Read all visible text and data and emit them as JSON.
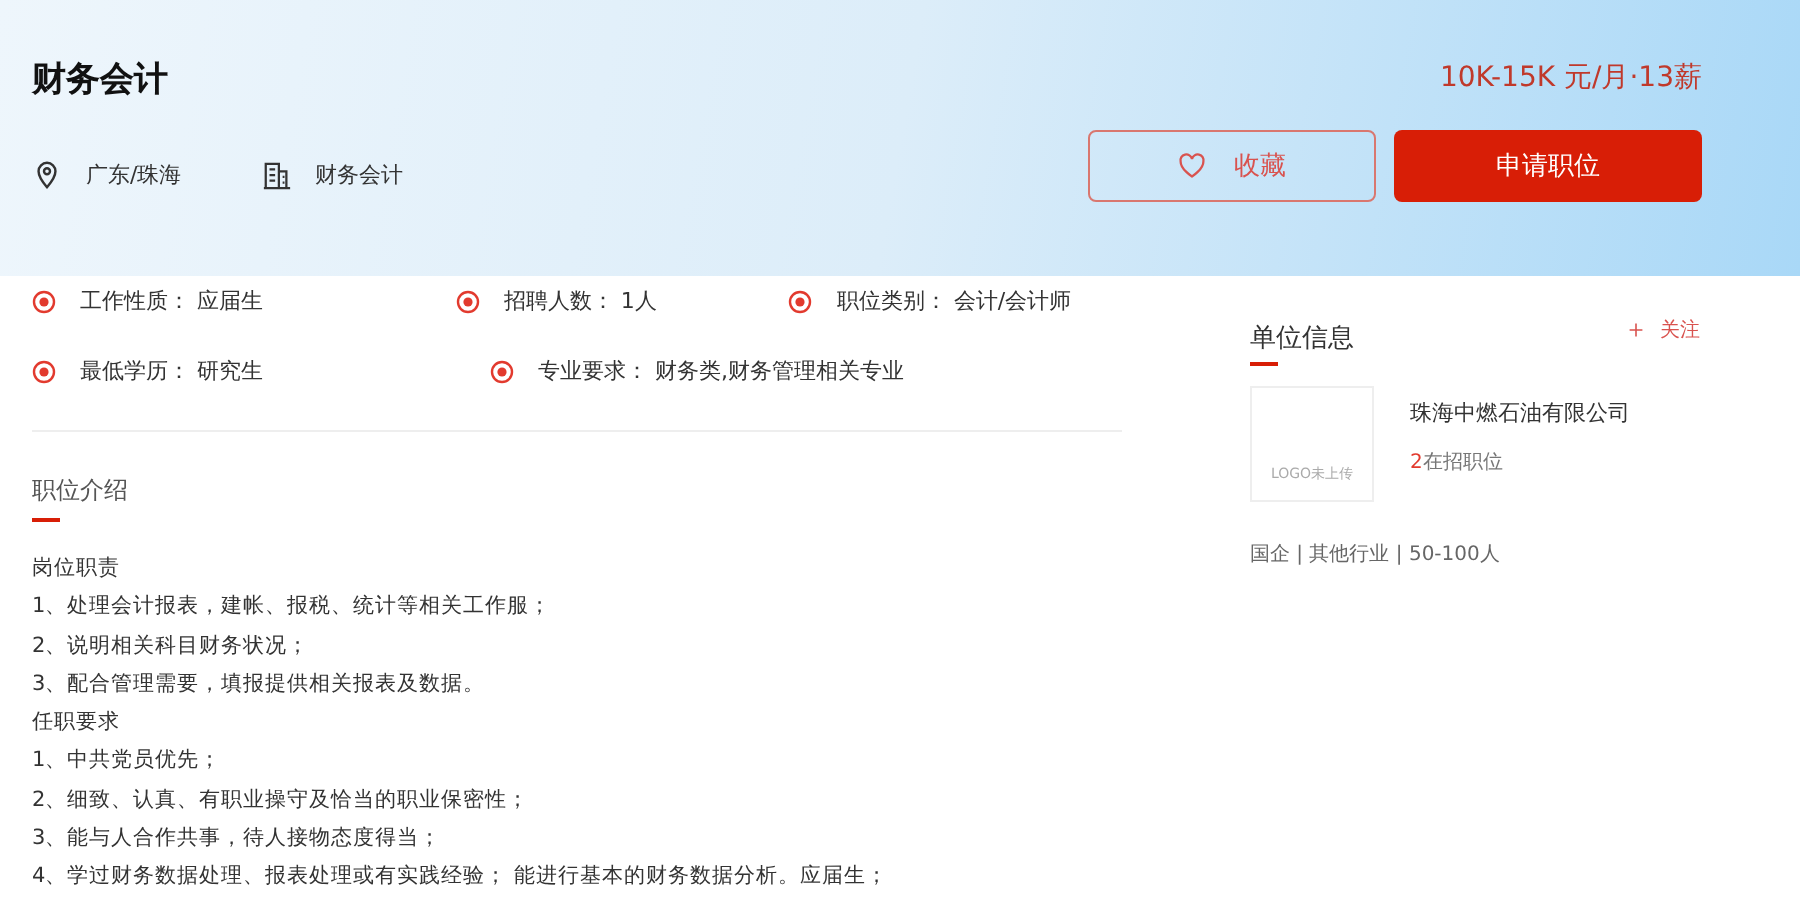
{
  "job": {
    "title": "财务会计",
    "location": "广东/珠海",
    "category": "财务会计",
    "salary": "10K-15K 元/月·13薪"
  },
  "buttons": [
    {
      "kind": "favorite",
      "label": "收藏"
    },
    {
      "kind": "apply",
      "label": "申请职位"
    }
  ],
  "info_rows": [
    [
      {
        "label": "工作性质：",
        "value": "应届生"
      },
      {
        "label": "招聘人数：",
        "value": "1人"
      },
      {
        "label": "职位类别：",
        "value": "会计/会计师"
      }
    ],
    [
      {
        "label": "最低学历：",
        "value": "研究生"
      },
      {
        "label": "专业要求：",
        "value": "财务类,财务管理相关专业"
      }
    ]
  ],
  "intro": {
    "heading": "职位介绍",
    "lines": [
      "岗位职责",
      "1、处理会计报表，建帐、报税、统计等相关工作服；",
      "2、说明相关科目财务状况；",
      "3、配合管理需要，填报提供相关报表及数据。",
      "任职要求",
      "1、中共党员优先；",
      "2、细致、认真、有职业操守及恰当的职业保密性；",
      "3、能与人合作共事，待人接物态度得当；",
      "4、学过财务数据处理、报表处理或有实践经验； 能进行基本的财务数据分析。应届生；"
    ]
  },
  "company": {
    "heading": "单位信息",
    "follow": "关注",
    "logo_text": "LOGO未上传",
    "name": "珠海中燃石油有限公司",
    "openings_count": "2",
    "openings_label": "在招职位",
    "tags": "国企 | 其他行业 | 50-100人"
  }
}
